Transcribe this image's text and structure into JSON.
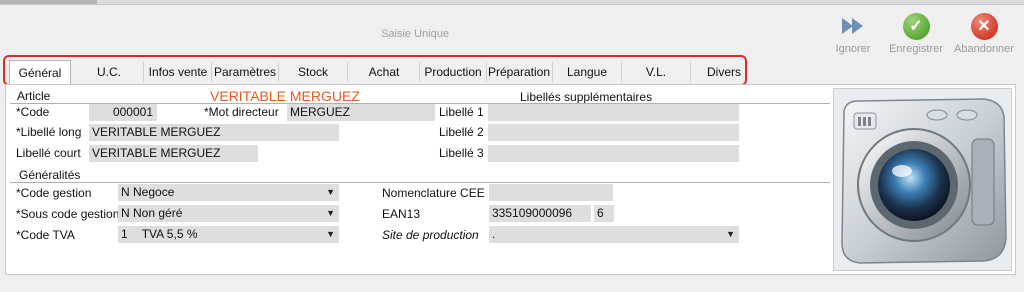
{
  "header": {
    "title": "Saisie Unique"
  },
  "actions": [
    {
      "label": "Ignorer",
      "icon": "fast-forward-icon"
    },
    {
      "label": "Enregistrer",
      "icon": "check-icon"
    },
    {
      "label": "Abandonner",
      "icon": "close-icon"
    }
  ],
  "tabs": [
    "Général",
    "U.C.",
    "Infos vente",
    "Paramètres",
    "Stock",
    "Achat",
    "Production",
    "Préparation",
    "Langue",
    "V.L.",
    "Divers"
  ],
  "article": {
    "section": "Article",
    "display_name": "VERITABLE MERGUEZ",
    "code_label": "*Code",
    "code_value": "000001",
    "mot_label": "*Mot directeur",
    "mot_value": "MERGUEZ",
    "long_label": "*Libellé long",
    "long_value": "VERITABLE MERGUEZ",
    "court_label": "Libellé court",
    "court_value": "VERITABLE MERGUEZ"
  },
  "libelles": {
    "section": "Libellés supplémentaires",
    "l1": "Libellé 1",
    "l2": "Libellé 2",
    "l3": "Libellé 3",
    "v1": "",
    "v2": "",
    "v3": ""
  },
  "generalites": {
    "section": "Généralités",
    "gestion_label": "*Code gestion",
    "gestion_value": "N Negoce",
    "sous_label": "*Sous code gestion",
    "sous_value": "N Non géré",
    "tva_label": "*Code TVA",
    "tva_code": "1",
    "tva_value": "TVA 5,5 %",
    "nomen_label": "Nomenclature CEE",
    "nomen_value": "",
    "ean_label": "EAN13",
    "ean_value": "335109000096",
    "ean_key": "6",
    "site_label": "Site de production",
    "site_value": "."
  },
  "colors": {
    "highlight": "#e02a2a",
    "accent_name": "#e85a1e"
  }
}
